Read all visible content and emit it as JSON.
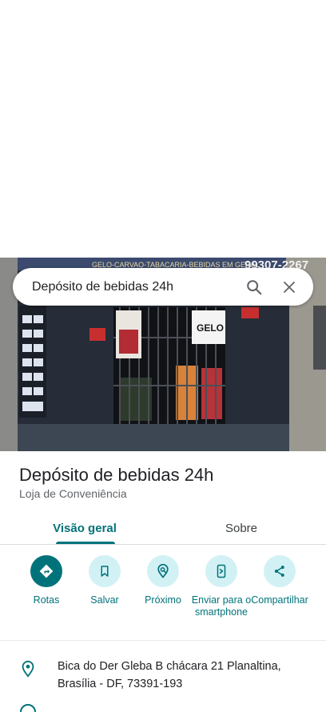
{
  "search": {
    "query": "Depósito de bebidas 24h"
  },
  "place": {
    "name": "Depósito de bebidas 24h",
    "category": "Loja de Conveniência",
    "storefront_sign": "GELO-CARVAO-TABACARIA-BEBIDAS EM GERAL",
    "storefront_phone": "99307-2267",
    "poster_text": "GELO"
  },
  "tabs": [
    {
      "label": "Visão geral",
      "active": true
    },
    {
      "label": "Sobre",
      "active": false
    }
  ],
  "actions": [
    {
      "label": "Rotas",
      "icon": "directions-icon"
    },
    {
      "label": "Salvar",
      "icon": "bookmark-icon"
    },
    {
      "label": "Próximo",
      "icon": "nearby-icon"
    },
    {
      "label": "Enviar para o smartphone",
      "icon": "send-to-phone-icon"
    },
    {
      "label": "Compartilhar",
      "icon": "share-icon"
    }
  ],
  "address": "Bica do Der Gleba B chácara 21 Planaltina, Brasília - DF, 73391-193",
  "colors": {
    "accent": "#00737a",
    "action_bg": "#d2f1f5"
  }
}
